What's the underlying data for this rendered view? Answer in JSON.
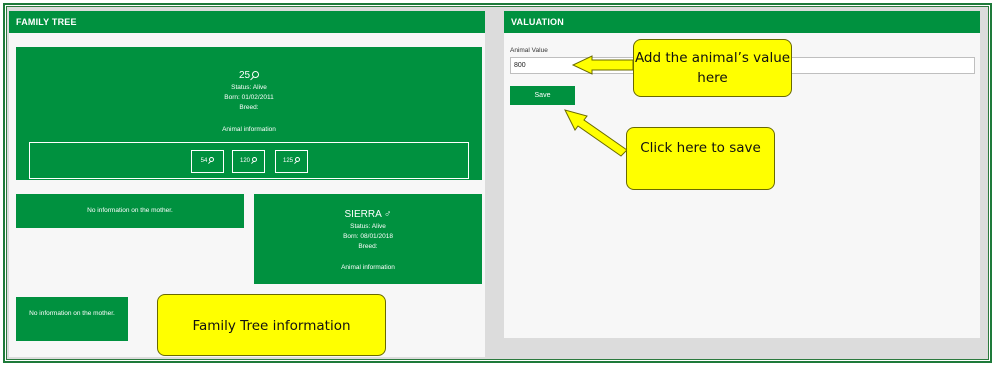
{
  "family_tree": {
    "header": "FAMILY TREE",
    "main_animal": {
      "name": "25",
      "status": "Status: Alive",
      "born": "Born: 01/02/2011",
      "breed": "Breed:",
      "info_link": "Animal information",
      "offspring": [
        "54",
        "120",
        "125"
      ]
    },
    "mother_top": "No information on the mother.",
    "father": {
      "name": "SIERRA",
      "sex_symbol": "♂",
      "status": "Status: Alive",
      "born": "Born: 08/01/2018",
      "breed": "Breed:",
      "info_link": "Animal information"
    },
    "mother_bottom": "No information on the mother."
  },
  "valuation": {
    "header": "VALUATION",
    "field_label": "Animal Value",
    "field_value": "800",
    "save_label": "Save"
  },
  "callouts": {
    "value": "Add the animal’s value here",
    "save": "Click here to save",
    "tree": "Family Tree information"
  },
  "colors": {
    "brand_green": "#00913f",
    "callout_yellow": "#ffff00"
  },
  "icons": {
    "search": "magnifier-icon",
    "male": "male-symbol-icon"
  }
}
